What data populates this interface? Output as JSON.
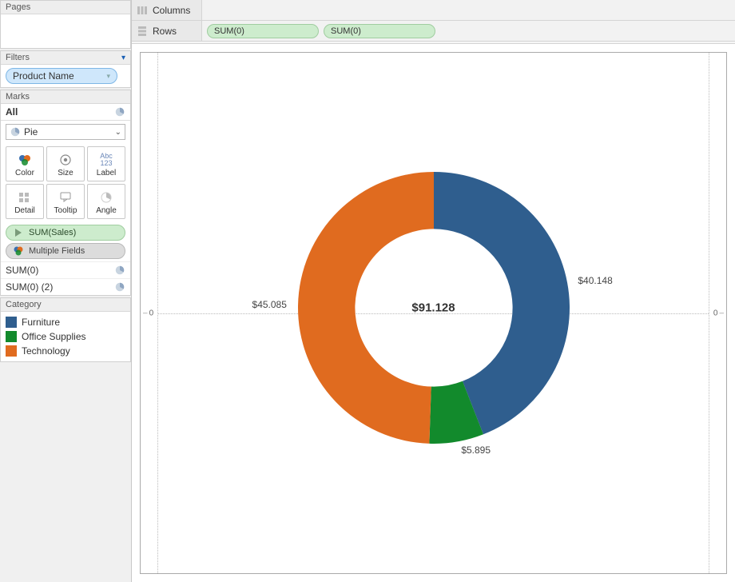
{
  "sidebar": {
    "pages_title": "Pages",
    "filters_title": "Filters",
    "filter_pill": "Product Name",
    "marks_title": "Marks",
    "marks_all": "All",
    "mark_type": "Pie",
    "mark_btns": {
      "color": "Color",
      "size": "Size",
      "label": "Label",
      "detail": "Detail",
      "tooltip": "Tooltip",
      "angle": "Angle"
    },
    "field_green": "SUM(Sales)",
    "field_grey": "Multiple Fields",
    "sum0_a": "SUM(0)",
    "sum0_b": "SUM(0) (2)",
    "category_title": "Category",
    "legend": [
      {
        "name": "Furniture",
        "color": "#2f5e8e"
      },
      {
        "name": "Office Supplies",
        "color": "#128a2c"
      },
      {
        "name": "Technology",
        "color": "#e06b1f"
      }
    ]
  },
  "shelves": {
    "columns_label": "Columns",
    "rows_label": "Rows",
    "row_pill_1": "SUM(0)",
    "row_pill_2": "SUM(0)"
  },
  "axes": {
    "left_zero": "0",
    "right_zero": "0"
  },
  "labels": {
    "total": "$91.128",
    "furniture": "$40.148",
    "office": "$5.895",
    "technology": "$45.085"
  },
  "chart_data": {
    "type": "pie",
    "title": "",
    "center_label": "$91.128",
    "total": 91.128,
    "series": [
      {
        "name": "Furniture",
        "value": 40.148,
        "color": "#2f5e8e",
        "label": "$40.148"
      },
      {
        "name": "Office Supplies",
        "value": 5.895,
        "color": "#128a2c",
        "label": "$5.895"
      },
      {
        "name": "Technology",
        "value": 45.085,
        "color": "#e06b1f",
        "label": "$45.085"
      }
    ],
    "donut_inner_ratio": 0.58
  }
}
